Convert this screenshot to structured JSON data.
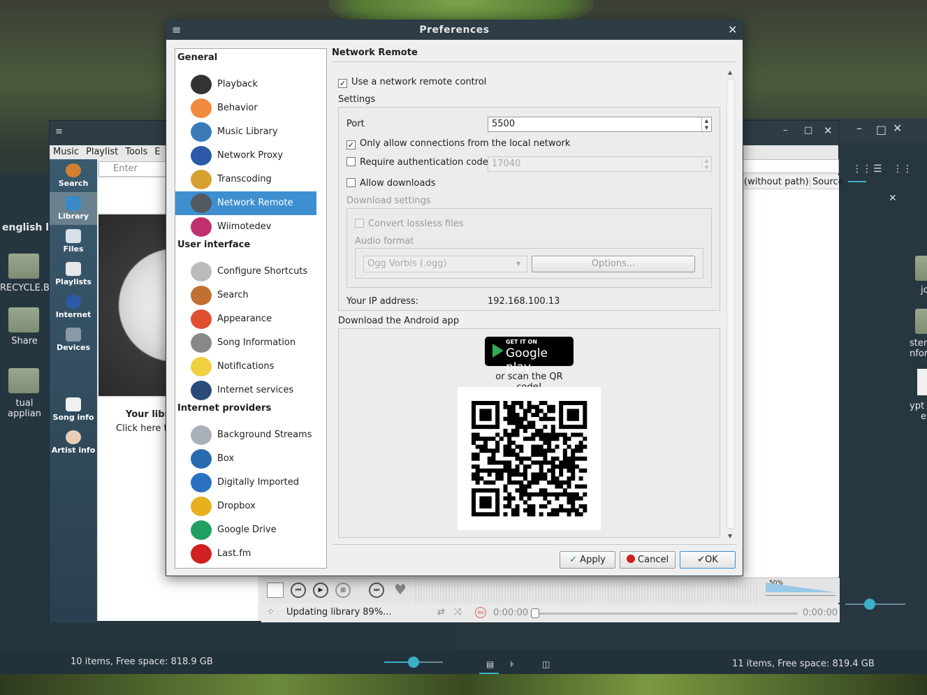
{
  "dialog": {
    "title": "Preferences",
    "categories": [
      {
        "type": "header",
        "label": "General"
      },
      {
        "type": "item",
        "label": "Playback",
        "icon": "playback-icon",
        "color": "#333333"
      },
      {
        "type": "item",
        "label": "Behavior",
        "icon": "behavior-icon",
        "color": "#f08a3c"
      },
      {
        "type": "item",
        "label": "Music Library",
        "icon": "music-library-icon",
        "color": "#3a7ab8"
      },
      {
        "type": "item",
        "label": "Network Proxy",
        "icon": "globe-icon",
        "color": "#2a5aa8"
      },
      {
        "type": "item",
        "label": "Transcoding",
        "icon": "transcoding-icon",
        "color": "#d8a030"
      },
      {
        "type": "item",
        "label": "Network Remote",
        "icon": "phone-icon",
        "color": "#505a60",
        "selected": true
      },
      {
        "type": "item",
        "label": "Wiimotedev",
        "icon": "wiimote-icon",
        "color": "#c03070"
      },
      {
        "type": "header",
        "label": "User interface"
      },
      {
        "type": "item",
        "label": "Configure Shortcuts",
        "icon": "keyboard-icon",
        "color": "#bbbbbb"
      },
      {
        "type": "item",
        "label": "Search",
        "icon": "search-icon",
        "color": "#c07030"
      },
      {
        "type": "item",
        "label": "Appearance",
        "icon": "appearance-icon",
        "color": "#e05030"
      },
      {
        "type": "item",
        "label": "Song Information",
        "icon": "song-info-icon",
        "color": "#888888"
      },
      {
        "type": "item",
        "label": "Notifications",
        "icon": "lightbulb-icon",
        "color": "#f0d040"
      },
      {
        "type": "item",
        "label": "Internet services",
        "icon": "headphones-icon",
        "color": "#2a4a7a"
      },
      {
        "type": "header",
        "label": "Internet providers"
      },
      {
        "type": "item",
        "label": "Background Streams",
        "icon": "weather-icon",
        "color": "#aab0b8"
      },
      {
        "type": "item",
        "label": "Box",
        "icon": "box-icon",
        "color": "#2a6ab0"
      },
      {
        "type": "item",
        "label": "Digitally Imported",
        "icon": "di-icon",
        "color": "#2a70c0"
      },
      {
        "type": "item",
        "label": "Dropbox",
        "icon": "dropbox-icon",
        "color": "#e8b020"
      },
      {
        "type": "item",
        "label": "Google Drive",
        "icon": "google-drive-icon",
        "color": "#20a060"
      },
      {
        "type": "item",
        "label": "Last.fm",
        "icon": "lastfm-icon",
        "color": "#d02020"
      }
    ],
    "page": {
      "title": "Network Remote",
      "use_remote_label": "Use a network remote control",
      "settings_label": "Settings",
      "port_label": "Port",
      "port_value": "5500",
      "local_only_label": "Only allow connections from the local network",
      "auth_label": "Require authentication code",
      "auth_value": "17040",
      "downloads_label": "Allow downloads",
      "download_settings_label": "Download settings",
      "convert_label": "Convert lossless files",
      "audio_format_label": "Audio format",
      "audio_format_value": "Ogg Vorbis (.ogg)",
      "options_label": "Options...",
      "ip_label": "Your IP address:",
      "ip_value": "192.168.100.13",
      "android_label": "Download the Android app",
      "gp_small": "GET IT ON",
      "gp_big": "Google play",
      "scan_label": "or scan the QR code!"
    },
    "buttons": {
      "apply": "Apply",
      "cancel": "Cancel",
      "ok": "OK"
    }
  },
  "clementine": {
    "menu": [
      "Music",
      "Playlist",
      "Tools",
      "E"
    ],
    "search_placeholder": "Enter search",
    "sidebar": [
      "Search",
      "Library",
      "Files",
      "Playlists",
      "Internet",
      "Devices",
      "Song info",
      "Artist info"
    ],
    "library_title": "Your libr",
    "library_sub": "Click here to",
    "columns": [
      "(without path)",
      "Source"
    ],
    "status": "Updating library 89%...",
    "time_left": "0:00:00",
    "time_right": "0:00:00",
    "volume": "50%"
  },
  "file_manager": {
    "left_status": "10 items, Free space: 818.9 GB",
    "right_status": "11 items, Free space: 819.4 GB",
    "left_header": "english le",
    "icons_left": [
      "RECYCLE.BI",
      "Share",
      "tual applian"
    ],
    "icons_right": [
      "jo",
      "stem",
      "nforr",
      "ypt",
      "e"
    ]
  }
}
